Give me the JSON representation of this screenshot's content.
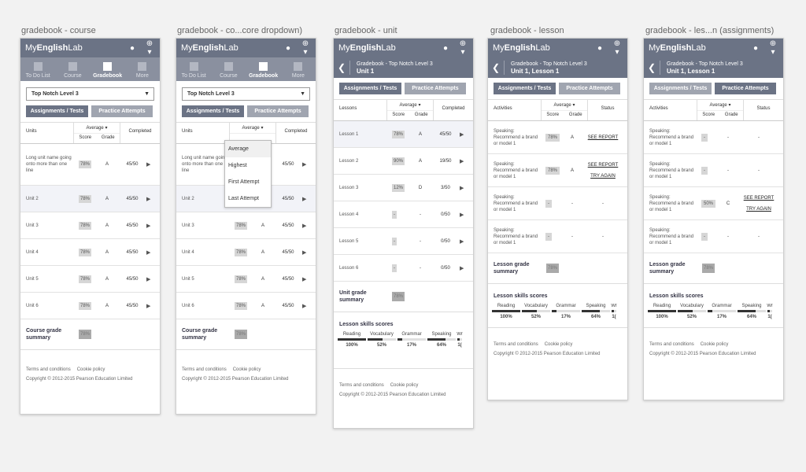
{
  "labels": [
    "gradebook - course",
    "gradebook - co...core dropdown)",
    "gradebook - unit",
    "gradebook - lesson",
    "gradebook - les...n (assignments)"
  ],
  "app": {
    "logo_pre": "My",
    "logo_bold": "English",
    "logo_post": "Lab",
    "tabs": [
      "To Do List",
      "Course",
      "Gradebook",
      "More"
    ]
  },
  "course": {
    "select": "Top Notch Level 3",
    "btn_assign": "Assignments / Tests",
    "btn_practice": "Practice Attempts",
    "col_units": "Units",
    "col_average": "Average",
    "col_score": "Score",
    "col_grade": "Grade",
    "col_completed": "Completed",
    "rows": [
      {
        "name": "Long unit name going onto more than one line",
        "score": "78%",
        "grade": "A",
        "completed": "45/50"
      },
      {
        "name": "Unit 2",
        "score": "78%",
        "grade": "A",
        "completed": "45/50"
      },
      {
        "name": "Unit 3",
        "score": "78%",
        "grade": "A",
        "completed": "45/50"
      },
      {
        "name": "Unit 4",
        "score": "78%",
        "grade": "A",
        "completed": "45/50"
      },
      {
        "name": "Unit 5",
        "score": "78%",
        "grade": "A",
        "completed": "45/50"
      },
      {
        "name": "Unit 6",
        "score": "78%",
        "grade": "A",
        "completed": "45/50"
      }
    ],
    "summary_label": "Course grade summary",
    "summary_value": "78%"
  },
  "dropdown": [
    "Average",
    "Highest",
    "First Attempt",
    "Last Attempt"
  ],
  "footer": {
    "terms": "Terms and conditions",
    "cookie": "Cookie policy",
    "copyright": "Copyright © 2012-2015 Pearson Education Limited"
  },
  "unit": {
    "crumb": "Gradebook - Top Notch Level 3",
    "title": "Unit 1",
    "col_lessons": "Lessons",
    "rows": [
      {
        "name": "Lesson 1",
        "score": "78%",
        "grade": "A",
        "completed": "45/50"
      },
      {
        "name": "Lesson 2",
        "score": "90%",
        "grade": "A",
        "completed": "19/50"
      },
      {
        "name": "Lesson 3",
        "score": "12%",
        "grade": "D",
        "completed": "3/50"
      },
      {
        "name": "Lesson 4",
        "score": "-",
        "grade": "-",
        "completed": "0/50"
      },
      {
        "name": "Lesson 5",
        "score": "-",
        "grade": "-",
        "completed": "0/50"
      },
      {
        "name": "Lesson 6",
        "score": "-",
        "grade": "-",
        "completed": "0/50"
      }
    ],
    "summary_label": "Unit grade summary",
    "summary_value": "78%"
  },
  "skills": {
    "title": "Lesson skills scores",
    "items": [
      {
        "name": "Reading",
        "pct": "100%",
        "fill": 1.0
      },
      {
        "name": "Vocabulary",
        "pct": "52%",
        "fill": 0.52
      },
      {
        "name": "Grammar",
        "pct": "17%",
        "fill": 0.17
      },
      {
        "name": "Speaking",
        "pct": "64%",
        "fill": 0.64
      },
      {
        "name": "Wr",
        "pct": "1(",
        "fill": 0.5
      }
    ]
  },
  "lesson": {
    "crumb": "Gradebook - Top Notch Level 3",
    "title": "Unit 1, Lesson 1",
    "col_activities": "Activities",
    "col_status": "Status",
    "activity": "Speaking: Recommend a brand or model 1",
    "see_report": "SEE REPORT",
    "try_again": "TRY AGAIN",
    "summary_label": "Lesson grade summary",
    "summary_value": "78%",
    "dash": "-",
    "score_78": "78%",
    "score_50": "50%",
    "grade_a": "A",
    "grade_c": "C"
  }
}
